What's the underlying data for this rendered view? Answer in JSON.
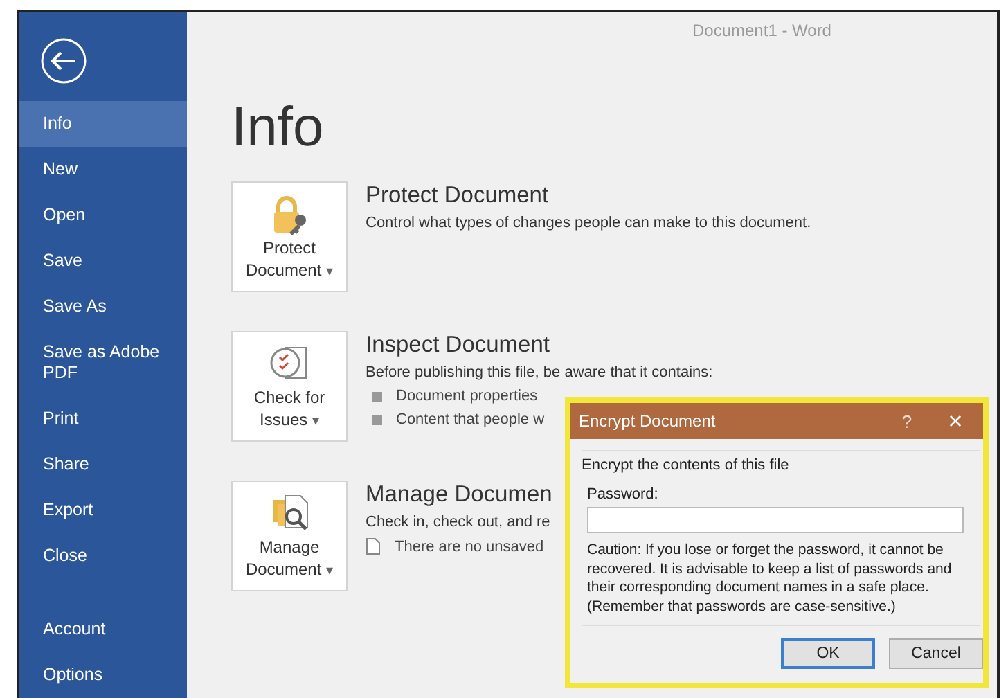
{
  "window": {
    "title": "Document1 - Word"
  },
  "sidebar": {
    "items": [
      {
        "label": "Info",
        "selected": true
      },
      {
        "label": "New",
        "selected": false
      },
      {
        "label": "Open",
        "selected": false
      },
      {
        "label": "Save",
        "selected": false
      },
      {
        "label": "Save As",
        "selected": false
      },
      {
        "label": "Save as Adobe PDF",
        "selected": false
      },
      {
        "label": "Print",
        "selected": false
      },
      {
        "label": "Share",
        "selected": false
      },
      {
        "label": "Export",
        "selected": false
      },
      {
        "label": "Close",
        "selected": false
      }
    ],
    "footer_items": [
      {
        "label": "Account",
        "selected": false
      },
      {
        "label": "Options",
        "selected": false
      }
    ]
  },
  "page_title": "Info",
  "sections": [
    {
      "kind": "protect",
      "button": [
        "Protect",
        "Document"
      ],
      "caret": "▾",
      "title": "Protect Document",
      "description": "Control what types of changes people can make to this document."
    },
    {
      "kind": "inspect",
      "button": [
        "Check for",
        "Issues"
      ],
      "caret": "▾",
      "title": "Inspect Document",
      "description": "Before publishing this file, be aware that it contains:",
      "bullets": [
        {
          "kind": "square",
          "text": "Document properties"
        },
        {
          "kind": "square",
          "text": "Content that people w"
        }
      ]
    },
    {
      "kind": "manage",
      "button": [
        "Manage",
        "Document"
      ],
      "caret": "▾",
      "title": "Manage Documen",
      "description": "Check in, check out, and re",
      "bullets": [
        {
          "kind": "page",
          "text": "There are no unsaved"
        }
      ]
    }
  ],
  "dialog": {
    "title": "Encrypt Document",
    "help": "?",
    "close": "×",
    "group_label": "Encrypt the contents of this file",
    "password_label": "Password:",
    "caution": "Caution: If you lose or forget the password, it cannot be recovered. It is advisable to keep a list of passwords and their corresponding document names in a safe place. (Remember that passwords are case-sensitive.)",
    "buttons": [
      {
        "label": "OK",
        "kind": "default"
      },
      {
        "label": "Cancel",
        "kind": "normal"
      }
    ]
  }
}
